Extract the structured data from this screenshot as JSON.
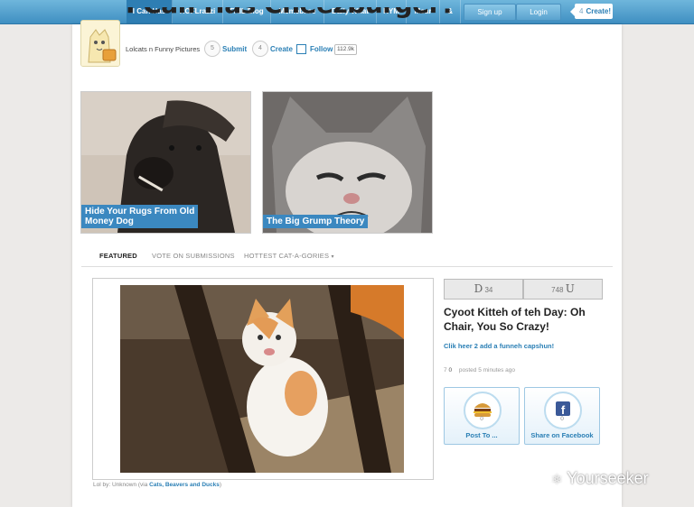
{
  "nav": {
    "items": [
      "I Can Has",
      "ROFLrazzi",
      "FAIL Blog",
      "Memebase",
      "Daily What",
      "KYM",
      "Moar",
      "&"
    ],
    "signup": "Sign up",
    "login": "Login",
    "create_count": "4",
    "create_label": "Create!"
  },
  "header": {
    "site_title": "I Can Has Cheezburger?",
    "subtitle": "Lolcats n Funny Pictures",
    "submit_count": "5",
    "submit_label": "Submit",
    "create_count": "4",
    "create_label": "Create",
    "follow_label": "Follow",
    "follow_count": "112.9k"
  },
  "featured": [
    {
      "caption_line1": "Hide Your Rugs From Old",
      "caption_line2": "Money Dog"
    },
    {
      "caption_line1": "The Big Grump Theory"
    }
  ],
  "tabs": [
    "FEATURED",
    "VOTE ON SUBMISSIONS",
    "HOTTEST CAT-A-GORIES"
  ],
  "post": {
    "credit_prefix": "Lol by: Unknown (via",
    "credit_link": "Cats, Beavers and Ducks",
    "credit_suffix": ")"
  },
  "sidebar": {
    "down_glyph": "D",
    "down_count": "34",
    "up_count": "748",
    "up_glyph": "U",
    "title": "Cyoot Kitteh of teh Day: Oh Chair, You So Crazy!",
    "caption_link": "Clik heer 2 add a funneh capshun!",
    "comment_glyph": "7",
    "comment_count": "0",
    "posted": "posted 5 minutes ago",
    "share": [
      {
        "label": "Post To ...",
        "count": "0",
        "icon": "cheezburger-icon"
      },
      {
        "label": "Share on Facebook",
        "count": "0",
        "icon": "facebook-icon"
      }
    ]
  },
  "watermark": "Yourseeker",
  "colors": {
    "nav_blue": "#3f8fc2",
    "link_blue": "#2a7fb5",
    "caption_blue": "#3b88c0"
  }
}
